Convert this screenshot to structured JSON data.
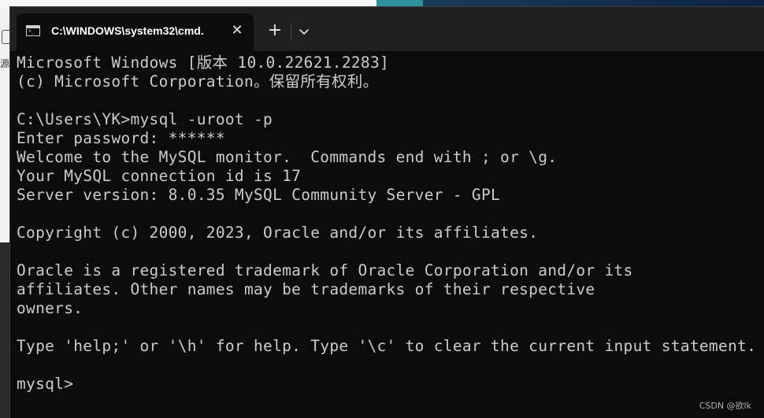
{
  "background": {
    "left_fragment_text": "源"
  },
  "window": {
    "tab": {
      "icon": "terminal-icon",
      "title": "C:\\WINDOWS\\system32\\cmd.",
      "close_glyph": "✕"
    },
    "new_tab_glyph": "+",
    "dropdown_icon": "chevron-down-icon"
  },
  "console": {
    "lines": [
      "Microsoft Windows [版本 10.0.22621.2283]",
      "(c) Microsoft Corporation。保留所有权利。",
      "",
      "C:\\Users\\YK>mysql -uroot -p",
      "Enter password: ******",
      "Welcome to the MySQL monitor.  Commands end with ; or \\g.",
      "Your MySQL connection id is 17",
      "Server version: 8.0.35 MySQL Community Server - GPL",
      "",
      "Copyright (c) 2000, 2023, Oracle and/or its affiliates.",
      "",
      "Oracle is a registered trademark of Oracle Corporation and/or its",
      "affiliates. Other names may be trademarks of their respective",
      "owners.",
      "",
      "Type 'help;' or '\\h' for help. Type '\\c' to clear the current input statement.",
      "",
      "mysql>"
    ]
  },
  "watermark": "CSDN @欲lk",
  "colors": {
    "console_bg": "#0c0c0c",
    "console_text": "#cccccc",
    "tabbar_bg": "#202020"
  }
}
